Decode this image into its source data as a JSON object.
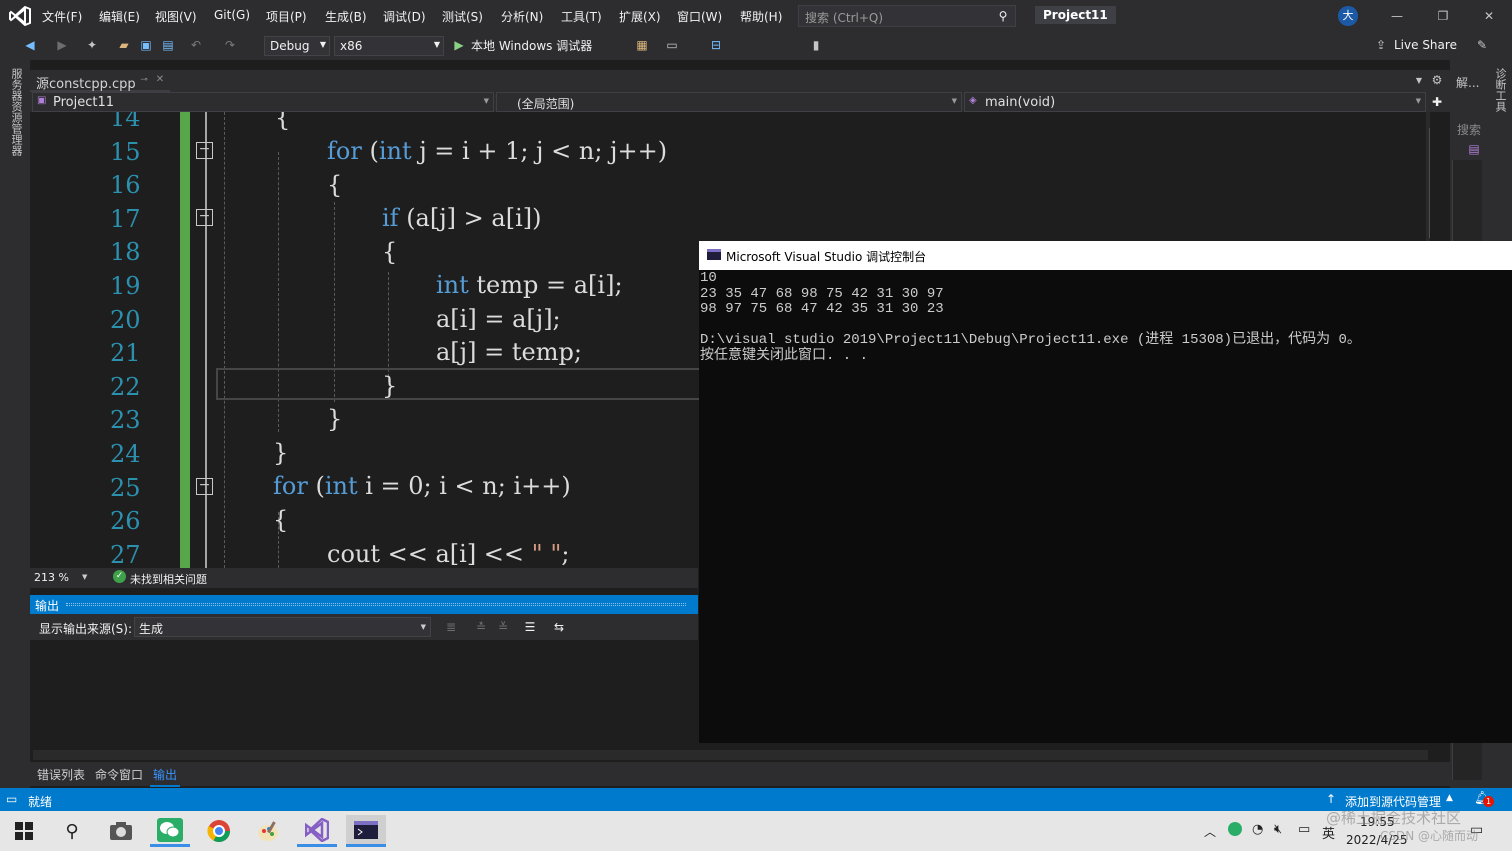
{
  "menu": {
    "items": [
      "文件(F)",
      "编辑(E)",
      "视图(V)",
      "Git(G)",
      "项目(P)",
      "生成(B)",
      "调试(D)",
      "测试(S)",
      "分析(N)",
      "工具(T)",
      "扩展(X)",
      "窗口(W)",
      "帮助(H)"
    ],
    "search_placeholder": "搜索 (Ctrl+Q)",
    "project_name": "Project11",
    "user_initial": "大"
  },
  "toolbar": {
    "config": "Debug",
    "platform": "x86",
    "run_label": "本地 Windows 调试器",
    "live_share": "Live Share"
  },
  "left_rail": {
    "label": "服务器资源管理器"
  },
  "right_rail": {
    "label": "诊断工具",
    "tab1": "解...",
    "tab2": "搜索"
  },
  "editor": {
    "tab_name": "源constcpp.cpp",
    "nav_project": "Project11",
    "nav_scope": "(全局范围)",
    "nav_member": "main(void)",
    "zoom": "213 %",
    "issues": "未找到相关问题",
    "line_numbers": [
      "14",
      "15",
      "16",
      "17",
      "18",
      "19",
      "20",
      "21",
      "22",
      "23",
      "24",
      "25",
      "26",
      "27"
    ]
  },
  "output": {
    "title": "输出",
    "source_label": "显示输出来源(S):",
    "source_value": "生成"
  },
  "bottom_tabs": [
    "错误列表",
    "命令窗口",
    "输出"
  ],
  "status": {
    "ready": "就绪",
    "source_control": "添加到源代码管理",
    "notifications": "1"
  },
  "console": {
    "title": "Microsoft Visual Studio 调试控制台",
    "lines": [
      "10",
      "23 35 47 68 98 75 42 31 30 97",
      "98 97 75 68 47 42 35 31 30 23",
      "",
      "D:\\visual studio 2019\\Project11\\Debug\\Project11.exe (进程 15308)已退出，代码为 0。",
      "按任意键关闭此窗口. . ."
    ]
  },
  "taskbar": {
    "time": "19:55",
    "date": "2022/4/25",
    "ime": "英",
    "watermark": "@稀土掘金技术社区",
    "watermark2": "CSDN @心随而动"
  }
}
